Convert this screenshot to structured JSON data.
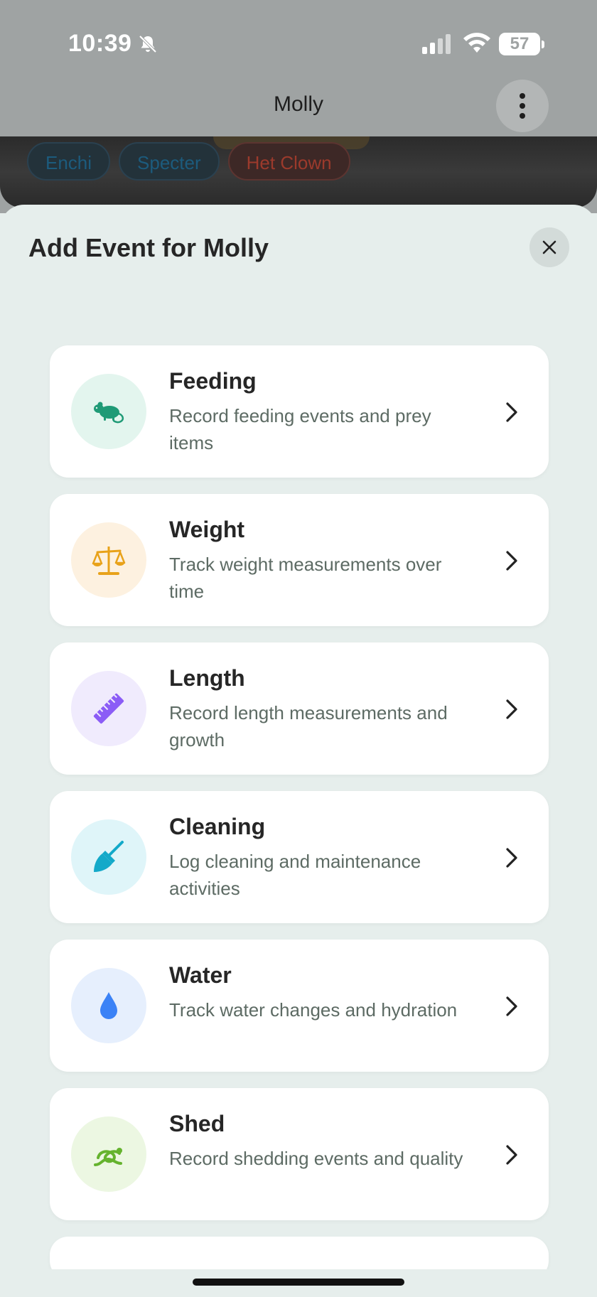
{
  "status_bar": {
    "time": "10:39",
    "battery": "57",
    "icons": [
      "bell-slash-icon",
      "cellular-signal-icon",
      "wifi-icon",
      "battery-icon"
    ]
  },
  "nav": {
    "title": "Molly",
    "more_icon": "more-vertical-icon"
  },
  "traits": [
    {
      "label": "Enchi",
      "color": "#1c5b7d"
    },
    {
      "label": "Specter",
      "color": "#1c5b7d"
    },
    {
      "label": "Het Clown",
      "color": "#9c3a2c"
    }
  ],
  "sheet": {
    "title": "Add Event for Molly",
    "close_icon": "close-icon"
  },
  "events": [
    {
      "title": "Feeding",
      "description": "Record feeding events and prey items",
      "icon": "rat-icon",
      "icon_color": "#1f9a76",
      "bg_color": "#e3f5ee"
    },
    {
      "title": "Weight",
      "description": "Track weight measurements over time",
      "icon": "scale-icon",
      "icon_color": "#e8a21a",
      "bg_color": "#fdf1e0"
    },
    {
      "title": "Length",
      "description": "Record length measurements and growth",
      "icon": "ruler-icon",
      "icon_color": "#8b5cf6",
      "bg_color": "#f0ebfd"
    },
    {
      "title": "Cleaning",
      "description": "Log cleaning and maintenance activities",
      "icon": "broom-icon",
      "icon_color": "#13a9c9",
      "bg_color": "#dff5f9"
    },
    {
      "title": "Water",
      "description": "Track water changes and hydration",
      "icon": "water-drop-icon",
      "icon_color": "#3b82f6",
      "bg_color": "#e6effd"
    },
    {
      "title": "Shed",
      "description": "Record shedding events and quality",
      "icon": "snake-icon",
      "icon_color": "#65b32e",
      "bg_color": "#ecf7e2"
    }
  ]
}
